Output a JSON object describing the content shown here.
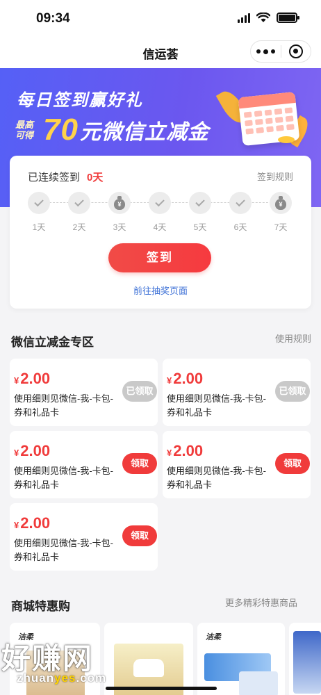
{
  "status_bar": {
    "time": "09:34"
  },
  "header": {
    "title": "信运荟"
  },
  "banner": {
    "headline": "每日签到赢好礼",
    "max_badge": "最高可得",
    "amount": "70",
    "unit_desc": "元微信立减金"
  },
  "signin": {
    "streak_label": "已连续签到",
    "streak_days": "0天",
    "rules_link": "签到规则",
    "days": [
      {
        "label": "1天",
        "type": "check"
      },
      {
        "label": "2天",
        "type": "check"
      },
      {
        "label": "3天",
        "type": "bag"
      },
      {
        "label": "4天",
        "type": "check"
      },
      {
        "label": "5天",
        "type": "check"
      },
      {
        "label": "6天",
        "type": "check"
      },
      {
        "label": "7天",
        "type": "bag"
      }
    ],
    "bag_symbol": "¥",
    "button": "签到",
    "lottery_link": "前往抽奖页面"
  },
  "coupons_section": {
    "title": "微信立减金专区",
    "rules_link": "使用规则",
    "items": [
      {
        "currency": "¥",
        "amount": "2.00",
        "desc": "使用细则见微信-我-卡包-券和礼品卡",
        "button": "已领取",
        "claimed": true
      },
      {
        "currency": "¥",
        "amount": "2.00",
        "desc": "使用细则见微信-我-卡包-券和礼品卡",
        "button": "已领取",
        "claimed": true
      },
      {
        "currency": "¥",
        "amount": "2.00",
        "desc": "使用细则见微信-我-卡包-券和礼品卡",
        "button": "领取",
        "claimed": false
      },
      {
        "currency": "¥",
        "amount": "2.00",
        "desc": "使用细则见微信-我-卡包-券和礼品卡",
        "button": "领取",
        "claimed": false
      },
      {
        "currency": "¥",
        "amount": "2.00",
        "desc": "使用细则见微信-我-卡包-券和礼品卡",
        "button": "领取",
        "claimed": false
      }
    ]
  },
  "mall_section": {
    "title": "商城特惠购",
    "more_link": "更多精彩特惠商品",
    "products": [
      {
        "brand": "洁柔"
      },
      {
        "brand": ""
      },
      {
        "brand": ""
      },
      {
        "brand": "洁柔"
      },
      {
        "brand": ""
      }
    ]
  },
  "watermark": {
    "big": "好赚网",
    "small_prefix": "zhuan",
    "small_highlight": "yes",
    "small_suffix": ".com"
  },
  "colors": {
    "accent_red": "#f03b3b",
    "banner_purple": "#5c5df4",
    "link_blue": "#3b6fd6"
  }
}
